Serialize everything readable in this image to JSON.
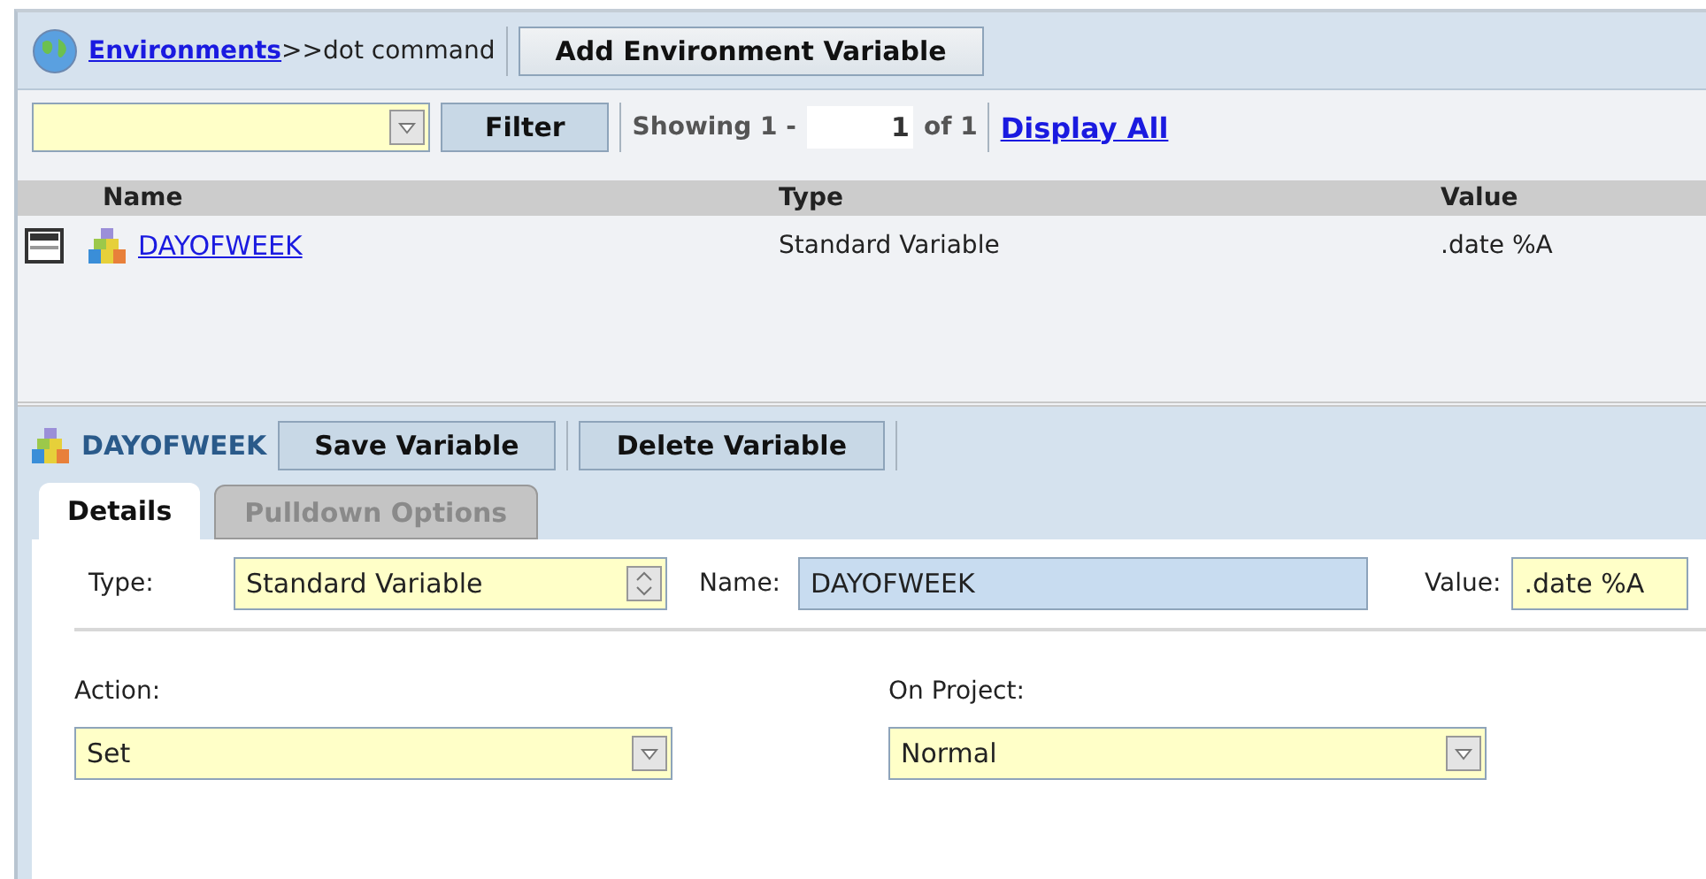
{
  "breadcrumb": {
    "link": "Environments",
    "separator": ">>",
    "current": "dot command"
  },
  "add_button": "Add Environment Variable",
  "filter": {
    "button": "Filter",
    "showing_label": "Showing 1 -",
    "page_value": "1",
    "of_label": "of 1",
    "display_all": "Display All"
  },
  "table": {
    "columns": [
      "Name",
      "Type",
      "Value"
    ],
    "rows": [
      {
        "name": "DAYOFWEEK",
        "type": "Standard Variable",
        "value": ".date %A"
      }
    ]
  },
  "detail": {
    "title": "DAYOFWEEK",
    "buttons": [
      "Save Variable",
      "Delete Variable"
    ],
    "tabs": [
      {
        "label": "Details",
        "selected": true
      },
      {
        "label": "Pulldown Options",
        "selected": false
      }
    ],
    "type_label": "Type:",
    "type_value": "Standard Variable",
    "name_label": "Name:",
    "name_value": "DAYOFWEEK",
    "value_label": "Value:",
    "value_value": ".date %A",
    "action_label": "Action:",
    "action_value": "Set",
    "project_label": "On Project:",
    "project_value": "Normal"
  }
}
